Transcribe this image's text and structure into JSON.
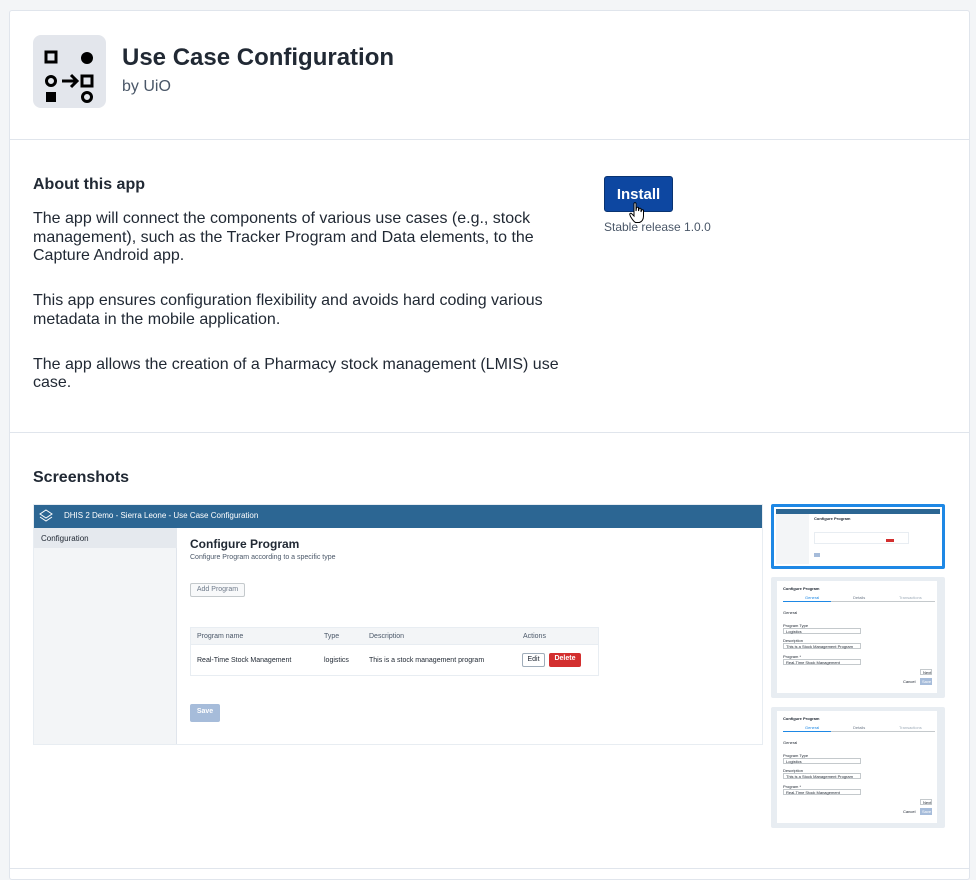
{
  "app": {
    "title": "Use Case Configuration",
    "developer": "by UiO"
  },
  "about": {
    "heading": "About this app",
    "paragraphs": [
      "The app will connect the components of various use cases (e.g., stock management), such as the Tracker Program and Data elements, to the Capture Android app.",
      "This app ensures configuration flexibility and avoids hard coding various metadata in the mobile application.",
      "The app allows the creation of a Pharmacy stock management (LMIS) use case."
    ],
    "install_label": "Install",
    "release_label": "Stable release 1.0.0"
  },
  "screenshots": {
    "heading": "Screenshots",
    "main": {
      "header_title": "DHIS 2 Demo - Sierra Leone - Use Case Configuration",
      "sidebar_item": "Configuration",
      "page_title": "Configure Program",
      "page_subtitle": "Configure Program according to a specific type",
      "add_button": "Add Program",
      "table_headers": [
        "Program name",
        "Type",
        "Description",
        "Actions"
      ],
      "row": {
        "name": "Real-Time Stock Management",
        "type": "logistics",
        "description": "This is a stock management program",
        "edit": "Edit",
        "delete": "Delete"
      },
      "save_button": "Save"
    },
    "thumb": {
      "title": "Configure Program",
      "tabs": [
        "General",
        "Details",
        "Transactions"
      ],
      "section": "General",
      "program_type_label": "Program Type",
      "program_type_value": "Logistics",
      "description_label": "Description",
      "description_value": "This is a Stock Management Program",
      "program_label": "Program *",
      "program_value": "Real-Time Stock Management",
      "next": "Next",
      "cancel": "Cancel",
      "save": "Save"
    }
  },
  "colors": {
    "primary": "#0d47a1",
    "header_bar": "#2c6693",
    "danger": "#d32f2f",
    "selected_thumb": "#1e88e5"
  }
}
